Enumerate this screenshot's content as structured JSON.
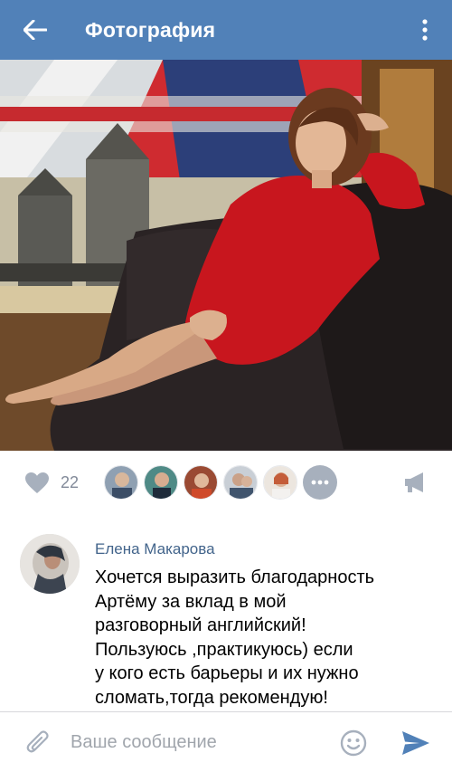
{
  "header": {
    "title": "Фотография",
    "back_icon": "arrow-left-icon",
    "menu_icon": "more-vertical-icon"
  },
  "photo": {
    "alt": "Фотография"
  },
  "actions": {
    "like_icon": "heart-icon",
    "like_count": "22",
    "share_icon": "megaphone-icon",
    "more_likers_icon": "ellipsis-icon"
  },
  "comment": {
    "author": "Елена Макарова",
    "text": "Хочется выразить благодарность\nАртёму за вклад в мой\nразговорный английский!\nПользуюсь ,практикуюсь) если\nу кого есть барьеры и их нужно\nсломать,тогда рекомендую!"
  },
  "composer": {
    "placeholder": "Ваше сообщение",
    "value": "",
    "attach_icon": "paperclip-icon",
    "emoji_icon": "smiley-icon",
    "send_icon": "send-icon"
  },
  "colors": {
    "header_bg": "#5181b8",
    "link": "#42648b",
    "icon_gray": "#a7b0bd",
    "send_blue": "#5181b8"
  }
}
